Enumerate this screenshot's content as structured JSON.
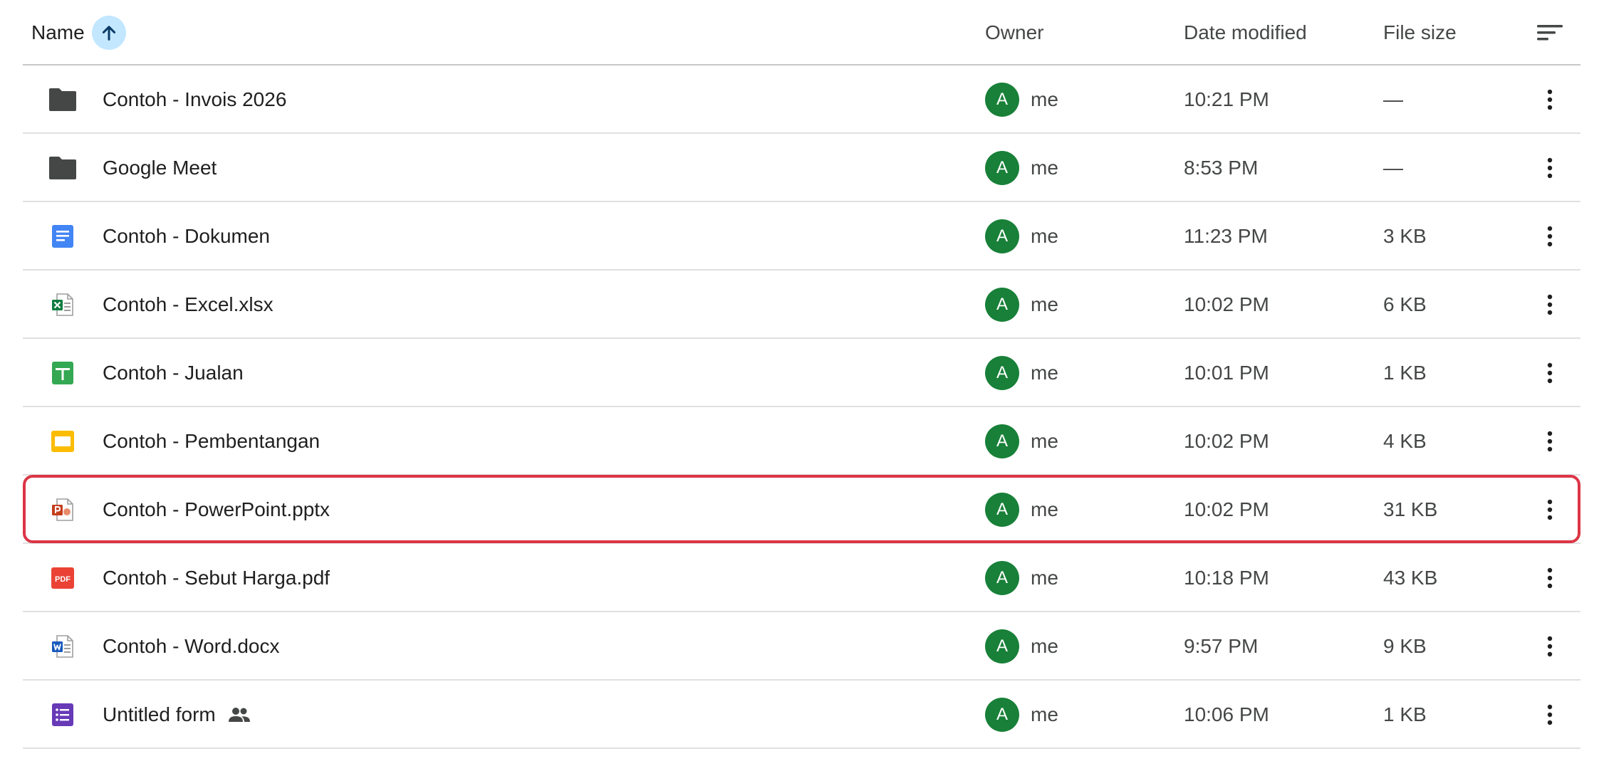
{
  "header": {
    "name_label": "Name",
    "owner_label": "Owner",
    "date_label": "Date modified",
    "size_label": "File size",
    "sort_direction": "ascending"
  },
  "colors": {
    "avatar": "#188038",
    "selection_outline": "#dc3545",
    "sort_button": "#c2e7ff"
  },
  "files": [
    {
      "name": "Contoh - Invois 2026",
      "icon": "folder-icon",
      "owner_initial": "A",
      "owner": "me",
      "date": "10:21 PM",
      "size": "—"
    },
    {
      "name": "Google Meet",
      "icon": "folder-icon",
      "owner_initial": "A",
      "owner": "me",
      "date": "8:53 PM",
      "size": "—"
    },
    {
      "name": "Contoh - Dokumen",
      "icon": "google-docs-icon",
      "owner_initial": "A",
      "owner": "me",
      "date": "11:23 PM",
      "size": "3 KB"
    },
    {
      "name": "Contoh - Excel.xlsx",
      "icon": "excel-file-icon",
      "owner_initial": "A",
      "owner": "me",
      "date": "10:02 PM",
      "size": "6 KB"
    },
    {
      "name": "Contoh - Jualan",
      "icon": "google-sheets-icon",
      "owner_initial": "A",
      "owner": "me",
      "date": "10:01 PM",
      "size": "1 KB"
    },
    {
      "name": "Contoh - Pembentangan",
      "icon": "google-slides-icon",
      "owner_initial": "A",
      "owner": "me",
      "date": "10:02 PM",
      "size": "4 KB"
    },
    {
      "name": "Contoh - PowerPoint.pptx",
      "icon": "powerpoint-file-icon",
      "owner_initial": "A",
      "owner": "me",
      "date": "10:02 PM",
      "size": "31 KB",
      "selected": true
    },
    {
      "name": "Contoh - Sebut Harga.pdf",
      "icon": "pdf-file-icon",
      "icon_text": "PDF",
      "owner_initial": "A",
      "owner": "me",
      "date": "10:18 PM",
      "size": "43 KB"
    },
    {
      "name": "Contoh - Word.docx",
      "icon": "word-file-icon",
      "owner_initial": "A",
      "owner": "me",
      "date": "9:57 PM",
      "size": "9 KB"
    },
    {
      "name": "Untitled form",
      "icon": "google-forms-icon",
      "shared": true,
      "owner_initial": "A",
      "owner": "me",
      "date": "10:06 PM",
      "size": "1 KB"
    }
  ]
}
